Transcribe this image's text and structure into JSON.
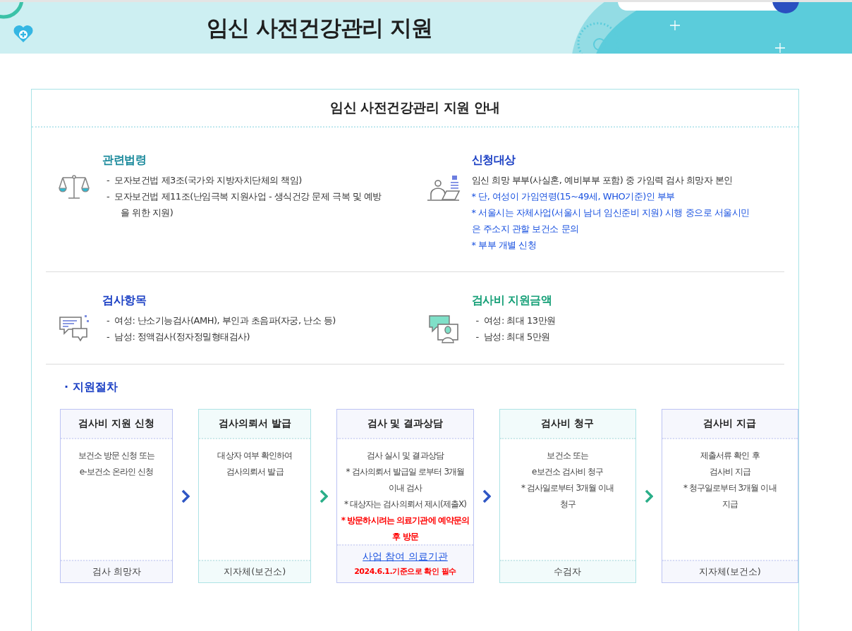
{
  "header": {
    "title": "임신 사전건강관리 지원"
  },
  "guide": {
    "title": "임신 사전건강관리 지원 안내",
    "sections": [
      {
        "title": "관련법령",
        "color": "#1b8a9c",
        "lines": [
          {
            "kind": "bullet",
            "text": "-  모자보건법 제3조(국가와 지방자치단체의 책임)"
          },
          {
            "kind": "bullet",
            "text": "-  모자보건법 제11조(난임극복 지원사업 - 생식건강 문제 극복 및 예방을 위한 지원)"
          }
        ]
      },
      {
        "title": "신청대상",
        "color": "#1a3fc4",
        "lines": [
          {
            "kind": "plain",
            "text": "임신 희망 부부(사실혼, 예비부부 포함) 중 가임력 검사 희망자 본인"
          },
          {
            "kind": "note",
            "text": "* 단, 여성이 가임연령(15~49세, WHO기준)인 부부"
          },
          {
            "kind": "note",
            "text": "* 서울시는 자체사업(서울시 남녀 임신준비 지원) 시행 중으로 서울시민은 주소지 관할 보건소 문의"
          },
          {
            "kind": "note",
            "text": "* 부부 개별 신청"
          }
        ]
      },
      {
        "title": "검사항목",
        "color": "#1a3fc4",
        "lines": [
          {
            "kind": "bullet",
            "text": "-  여성: 난소기능검사(AMH), 부인과 초음파(자궁, 난소 등)"
          },
          {
            "kind": "bullet",
            "text": "-  남성: 정액검사(정자정밀형태검사)"
          }
        ]
      },
      {
        "title": "검사비 지원금액",
        "color": "#17a078",
        "lines": [
          {
            "kind": "bullet",
            "text": "-  여성: 최대 13만원"
          },
          {
            "kind": "bullet",
            "text": "-  남성: 최대 5만원"
          }
        ]
      }
    ],
    "procedure": {
      "title": "· 지원절차",
      "steps": [
        {
          "title": "검사비 지원 신청",
          "lines": [
            {
              "kind": "plain",
              "text": "보건소 방문 신청 또는"
            },
            {
              "kind": "plain",
              "text": "e-보건소 온라인 신청"
            }
          ],
          "footer": [
            {
              "kind": "plain",
              "text": "검사 희망자"
            }
          ]
        },
        {
          "title": "검사의뢰서 발급",
          "lines": [
            {
              "kind": "plain",
              "text": "대상자 여부 확인하여"
            },
            {
              "kind": "plain",
              "text": "검사의뢰서 발급"
            }
          ],
          "footer": [
            {
              "kind": "plain",
              "text": "지자체(보건소)"
            }
          ]
        },
        {
          "title": "검사 및 결과상담",
          "lines": [
            {
              "kind": "plain",
              "text": "검사 실시 및 결과상담"
            },
            {
              "kind": "plain",
              "text": "* 검사의뢰서 발급일 로부터 3개월"
            },
            {
              "kind": "plain",
              "text": "이내 검사"
            },
            {
              "kind": "plain",
              "text": "* 대상자는 검사의뢰서 제시(제출X)"
            },
            {
              "kind": "warning",
              "text": "* 방문하시려는 의료기관에 예약문의"
            },
            {
              "kind": "warning",
              "text": "후 방문"
            }
          ],
          "footer": [
            {
              "kind": "link",
              "text": "사업 참여 의료기관"
            },
            {
              "kind": "warning",
              "text": "2024.6.1.기준으로 확인 필수"
            }
          ]
        },
        {
          "title": "검사비 청구",
          "lines": [
            {
              "kind": "plain",
              "text": "보건소 또는"
            },
            {
              "kind": "plain",
              "text": "e보건소 검사비 청구"
            },
            {
              "kind": "plain",
              "text": "* 검사일로부터 3개월 이내"
            },
            {
              "kind": "plain",
              "text": "청구"
            }
          ],
          "footer": [
            {
              "kind": "plain",
              "text": "수검자"
            }
          ]
        },
        {
          "title": "검사비 지급",
          "lines": [
            {
              "kind": "plain",
              "text": "제출서류 확인 후"
            },
            {
              "kind": "plain",
              "text": "검사비 지급"
            },
            {
              "kind": "plain",
              "text": "* 청구일로부터 3개월 이내"
            },
            {
              "kind": "plain",
              "text": "지급"
            }
          ],
          "footer": [
            {
              "kind": "plain",
              "text": "지자체(보건소)"
            }
          ]
        }
      ]
    }
  }
}
